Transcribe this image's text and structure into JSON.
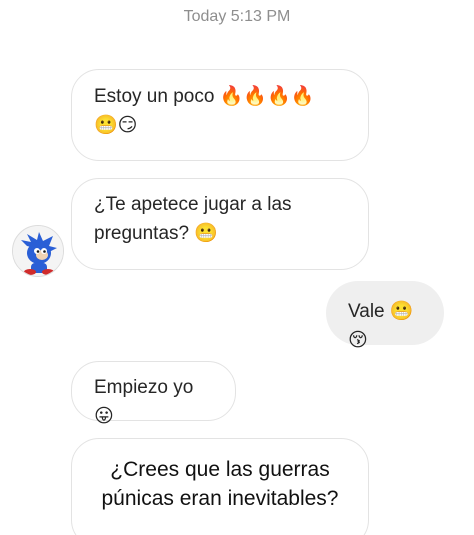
{
  "header": {
    "timestamp": "Today 5:13 PM"
  },
  "messages": [
    {
      "side": "received",
      "text": "Estoy un poco",
      "emoji_line1": "🔥🔥🔥🔥",
      "emoji_line2": "😬😏"
    },
    {
      "side": "received",
      "text_line1": "¿Te apetece jugar a las",
      "text_line2": "preguntas?",
      "emoji": "😬"
    },
    {
      "side": "sent",
      "text": "Vale",
      "emoji": "😬😚"
    },
    {
      "side": "received",
      "text": "Empiezo yo",
      "emoji": "😛"
    },
    {
      "side": "received",
      "text_line1": "¿Crees que las guerras",
      "text_line2": "púnicas eran inevitables?"
    }
  ],
  "colors": {
    "received_bubble_border": "#e3e3e3",
    "sent_bubble_bg": "#efefef",
    "timestamp_text": "#8e8e8e",
    "avatar_accent": "#2a5fd6"
  },
  "icons": {
    "avatar": "sonic-avatar-icon"
  }
}
